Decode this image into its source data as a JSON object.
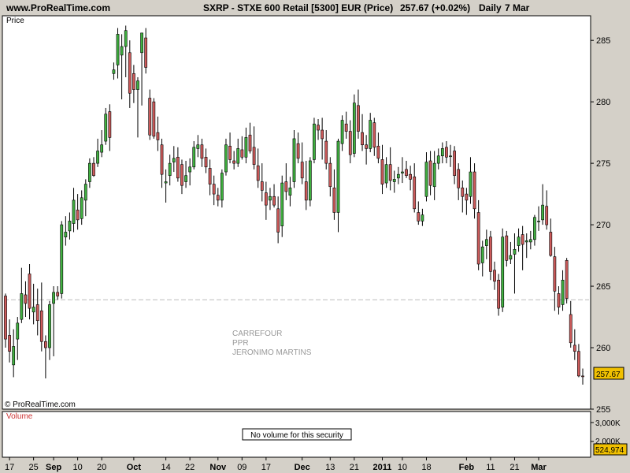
{
  "header": {
    "site": "www.ProRealTime.com",
    "title": "SXRP - STXE 600 Retail [5300] EUR (Price)",
    "price": "257.67 (+0.02%)",
    "period": "Daily",
    "date": "7 Mar"
  },
  "price_panel": {
    "label": "Price",
    "watermark": "© ProRealTime.com",
    "last_price_label": "257.67",
    "reference_level": 263.9,
    "annotations": [
      "CARREFOUR",
      "PPR",
      "JERONIMO MARTINS"
    ]
  },
  "volume_panel": {
    "label": "Volume",
    "message": "No volume for this security",
    "y_ticks": [
      "3,000K",
      "2,000K"
    ],
    "last_value_label": "524,974"
  },
  "colors": {
    "up": "#40b040",
    "down": "#cc5a5a",
    "wick": "#000000",
    "last_price_box": "#f0c000",
    "panel_bg": "#ffffff",
    "frame_bg": "#d4d0c8"
  },
  "chart_data": {
    "type": "candlestick",
    "ylim": [
      255,
      287
    ],
    "y_ticks": [
      255,
      260,
      265,
      270,
      275,
      280,
      285
    ],
    "x_ticks": [
      {
        "label": "17",
        "i": 1,
        "bold": false
      },
      {
        "label": "25",
        "i": 7,
        "bold": false
      },
      {
        "label": "Sep",
        "i": 12,
        "bold": true
      },
      {
        "label": "10",
        "i": 18,
        "bold": false
      },
      {
        "label": "20",
        "i": 24,
        "bold": false
      },
      {
        "label": "Oct",
        "i": 32,
        "bold": true
      },
      {
        "label": "14",
        "i": 40,
        "bold": false
      },
      {
        "label": "22",
        "i": 46,
        "bold": false
      },
      {
        "label": "Nov",
        "i": 53,
        "bold": true
      },
      {
        "label": "09",
        "i": 59,
        "bold": false
      },
      {
        "label": "17",
        "i": 65,
        "bold": false
      },
      {
        "label": "Dec",
        "i": 74,
        "bold": true
      },
      {
        "label": "13",
        "i": 81,
        "bold": false
      },
      {
        "label": "21",
        "i": 87,
        "bold": false
      },
      {
        "label": "2011",
        "i": 94,
        "bold": true
      },
      {
        "label": "10",
        "i": 99,
        "bold": false
      },
      {
        "label": "18",
        "i": 105,
        "bold": false
      },
      {
        "label": "Feb",
        "i": 115,
        "bold": true
      },
      {
        "label": "11",
        "i": 121,
        "bold": false
      },
      {
        "label": "21",
        "i": 127,
        "bold": false
      },
      {
        "label": "Mar",
        "i": 133,
        "bold": true
      }
    ],
    "candles": [
      {
        "o": 264.2,
        "h": 264.4,
        "l": 260.0,
        "c": 260.7
      },
      {
        "o": 261.0,
        "h": 262.3,
        "l": 258.8,
        "c": 259.7
      },
      {
        "o": 258.6,
        "h": 261.5,
        "l": 257.6,
        "c": 260.1
      },
      {
        "o": 260.7,
        "h": 262.5,
        "l": 259.0,
        "c": 262.0
      },
      {
        "o": 262.3,
        "h": 266.5,
        "l": 262.0,
        "c": 264.4
      },
      {
        "o": 264.3,
        "h": 265.4,
        "l": 262.5,
        "c": 263.6
      },
      {
        "o": 266.0,
        "h": 266.8,
        "l": 262.3,
        "c": 263.2
      },
      {
        "o": 262.9,
        "h": 265.2,
        "l": 261.9,
        "c": 263.3
      },
      {
        "o": 263.5,
        "h": 264.8,
        "l": 261.0,
        "c": 262.2
      },
      {
        "o": 263.0,
        "h": 265.3,
        "l": 259.7,
        "c": 260.5
      },
      {
        "o": 260.5,
        "h": 261.0,
        "l": 257.5,
        "c": 260.0
      },
      {
        "o": 260.0,
        "h": 263.8,
        "l": 259.0,
        "c": 263.5
      },
      {
        "o": 263.6,
        "h": 265.0,
        "l": 259.3,
        "c": 264.5
      },
      {
        "o": 264.5,
        "h": 265.0,
        "l": 263.9,
        "c": 264.2
      },
      {
        "o": 264.4,
        "h": 270.3,
        "l": 264.0,
        "c": 270.0
      },
      {
        "o": 269.0,
        "h": 270.7,
        "l": 268.3,
        "c": 269.4
      },
      {
        "o": 269.5,
        "h": 271.0,
        "l": 268.8,
        "c": 270.3
      },
      {
        "o": 270.1,
        "h": 273.0,
        "l": 269.4,
        "c": 272.0
      },
      {
        "o": 271.2,
        "h": 272.5,
        "l": 269.6,
        "c": 270.4
      },
      {
        "o": 270.5,
        "h": 272.8,
        "l": 270.0,
        "c": 272.2
      },
      {
        "o": 272.0,
        "h": 273.7,
        "l": 270.7,
        "c": 273.3
      },
      {
        "o": 273.5,
        "h": 275.4,
        "l": 273.0,
        "c": 275.0
      },
      {
        "o": 275.0,
        "h": 275.5,
        "l": 273.9,
        "c": 274.0
      },
      {
        "o": 275.0,
        "h": 277.0,
        "l": 274.7,
        "c": 276.0
      },
      {
        "o": 275.9,
        "h": 277.7,
        "l": 275.5,
        "c": 276.5
      },
      {
        "o": 276.8,
        "h": 279.5,
        "l": 276.5,
        "c": 279.0
      },
      {
        "o": 279.2,
        "h": 279.8,
        "l": 276.0,
        "c": 277.1
      },
      {
        "o": 282.3,
        "h": 283.2,
        "l": 281.8,
        "c": 282.6
      },
      {
        "o": 283.0,
        "h": 286.0,
        "l": 281.9,
        "c": 285.5
      },
      {
        "o": 283.8,
        "h": 285.5,
        "l": 280.2,
        "c": 284.5
      },
      {
        "o": 284.5,
        "h": 286.2,
        "l": 282.0,
        "c": 285.8
      },
      {
        "o": 284.0,
        "h": 285.0,
        "l": 279.5,
        "c": 280.7
      },
      {
        "o": 282.3,
        "h": 283.0,
        "l": 279.9,
        "c": 281.0
      },
      {
        "o": 281.0,
        "h": 282.0,
        "l": 277.1,
        "c": 281.7
      },
      {
        "o": 284.0,
        "h": 284.8,
        "l": 279.7,
        "c": 285.6
      },
      {
        "o": 285.2,
        "h": 286.0,
        "l": 282.3,
        "c": 282.8
      },
      {
        "o": 280.3,
        "h": 281.0,
        "l": 276.9,
        "c": 277.3
      },
      {
        "o": 280.0,
        "h": 280.3,
        "l": 277.0,
        "c": 277.2
      },
      {
        "o": 277.5,
        "h": 278.8,
        "l": 276.0,
        "c": 276.9
      },
      {
        "o": 276.5,
        "h": 277.0,
        "l": 273.0,
        "c": 274.1
      },
      {
        "o": 273.4,
        "h": 274.5,
        "l": 271.8,
        "c": 273.5
      },
      {
        "o": 274.0,
        "h": 275.7,
        "l": 273.2,
        "c": 275.0
      },
      {
        "o": 275.1,
        "h": 276.4,
        "l": 274.3,
        "c": 275.4
      },
      {
        "o": 275.5,
        "h": 276.3,
        "l": 273.5,
        "c": 273.8
      },
      {
        "o": 274.9,
        "h": 275.3,
        "l": 272.5,
        "c": 273.2
      },
      {
        "o": 273.5,
        "h": 275.2,
        "l": 273.0,
        "c": 274.0
      },
      {
        "o": 274.3,
        "h": 275.4,
        "l": 273.2,
        "c": 274.7
      },
      {
        "o": 274.7,
        "h": 276.8,
        "l": 274.5,
        "c": 276.3
      },
      {
        "o": 276.2,
        "h": 277.3,
        "l": 275.5,
        "c": 276.5
      },
      {
        "o": 276.5,
        "h": 277.0,
        "l": 274.7,
        "c": 275.4
      },
      {
        "o": 275.5,
        "h": 276.2,
        "l": 274.2,
        "c": 274.7
      },
      {
        "o": 274.6,
        "h": 275.3,
        "l": 272.4,
        "c": 273.3
      },
      {
        "o": 273.3,
        "h": 274.0,
        "l": 271.6,
        "c": 272.5
      },
      {
        "o": 272.4,
        "h": 273.0,
        "l": 271.5,
        "c": 272.0
      },
      {
        "o": 272.0,
        "h": 274.5,
        "l": 271.4,
        "c": 274.2
      },
      {
        "o": 274.3,
        "h": 277.0,
        "l": 274.0,
        "c": 276.5
      },
      {
        "o": 276.4,
        "h": 277.5,
        "l": 275.0,
        "c": 275.3
      },
      {
        "o": 275.2,
        "h": 276.0,
        "l": 274.5,
        "c": 275.0
      },
      {
        "o": 275.0,
        "h": 277.0,
        "l": 274.7,
        "c": 276.2
      },
      {
        "o": 276.1,
        "h": 277.2,
        "l": 275.3,
        "c": 275.5
      },
      {
        "o": 275.5,
        "h": 277.9,
        "l": 275.0,
        "c": 277.1
      },
      {
        "o": 277.3,
        "h": 278.3,
        "l": 275.8,
        "c": 276.0
      },
      {
        "o": 276.3,
        "h": 278.0,
        "l": 274.5,
        "c": 274.9
      },
      {
        "o": 274.8,
        "h": 276.2,
        "l": 273.0,
        "c": 273.6
      },
      {
        "o": 273.5,
        "h": 275.0,
        "l": 271.9,
        "c": 272.8
      },
      {
        "o": 272.6,
        "h": 273.5,
        "l": 270.4,
        "c": 271.6
      },
      {
        "o": 272.0,
        "h": 273.0,
        "l": 271.2,
        "c": 272.3
      },
      {
        "o": 272.3,
        "h": 273.3,
        "l": 271.4,
        "c": 271.6
      },
      {
        "o": 271.3,
        "h": 272.3,
        "l": 268.5,
        "c": 269.4
      },
      {
        "o": 269.9,
        "h": 274.0,
        "l": 269.0,
        "c": 273.4
      },
      {
        "o": 273.5,
        "h": 275.0,
        "l": 272.0,
        "c": 272.7
      },
      {
        "o": 272.4,
        "h": 273.9,
        "l": 271.5,
        "c": 273.0
      },
      {
        "o": 273.5,
        "h": 277.7,
        "l": 273.0,
        "c": 277.0
      },
      {
        "o": 276.6,
        "h": 277.5,
        "l": 275.0,
        "c": 275.4
      },
      {
        "o": 275.1,
        "h": 276.7,
        "l": 273.3,
        "c": 273.8
      },
      {
        "o": 273.5,
        "h": 275.2,
        "l": 271.2,
        "c": 272.0
      },
      {
        "o": 272.0,
        "h": 275.5,
        "l": 271.5,
        "c": 275.2
      },
      {
        "o": 275.3,
        "h": 278.7,
        "l": 275.0,
        "c": 278.2
      },
      {
        "o": 278.1,
        "h": 278.6,
        "l": 276.9,
        "c": 277.7
      },
      {
        "o": 277.7,
        "h": 278.7,
        "l": 275.3,
        "c": 277.0
      },
      {
        "o": 276.8,
        "h": 277.7,
        "l": 274.5,
        "c": 275.0
      },
      {
        "o": 275.0,
        "h": 275.5,
        "l": 272.3,
        "c": 273.1
      },
      {
        "o": 273.0,
        "h": 274.5,
        "l": 270.4,
        "c": 271.0
      },
      {
        "o": 271.0,
        "h": 277.0,
        "l": 269.4,
        "c": 276.8
      },
      {
        "o": 276.6,
        "h": 278.9,
        "l": 276.0,
        "c": 278.5
      },
      {
        "o": 278.2,
        "h": 279.2,
        "l": 277.0,
        "c": 277.6
      },
      {
        "o": 277.6,
        "h": 278.5,
        "l": 275.0,
        "c": 275.7
      },
      {
        "o": 275.8,
        "h": 280.6,
        "l": 275.5,
        "c": 279.9
      },
      {
        "o": 279.7,
        "h": 281.0,
        "l": 277.0,
        "c": 277.6
      },
      {
        "o": 277.5,
        "h": 279.0,
        "l": 276.0,
        "c": 276.5
      },
      {
        "o": 276.5,
        "h": 277.3,
        "l": 274.9,
        "c": 276.2
      },
      {
        "o": 276.2,
        "h": 279.1,
        "l": 275.9,
        "c": 278.5
      },
      {
        "o": 278.3,
        "h": 278.7,
        "l": 275.6,
        "c": 276.3
      },
      {
        "o": 276.4,
        "h": 277.5,
        "l": 275.0,
        "c": 275.4
      },
      {
        "o": 275.3,
        "h": 276.5,
        "l": 272.5,
        "c": 273.3
      },
      {
        "o": 273.4,
        "h": 275.5,
        "l": 273.0,
        "c": 274.9
      },
      {
        "o": 274.9,
        "h": 276.3,
        "l": 272.8,
        "c": 273.6
      },
      {
        "o": 273.5,
        "h": 274.4,
        "l": 272.6,
        "c": 273.7
      },
      {
        "o": 273.8,
        "h": 274.7,
        "l": 273.3,
        "c": 274.1
      },
      {
        "o": 274.2,
        "h": 275.5,
        "l": 273.4,
        "c": 274.3
      },
      {
        "o": 274.5,
        "h": 275.2,
        "l": 273.8,
        "c": 274.0
      },
      {
        "o": 274.1,
        "h": 274.8,
        "l": 272.8,
        "c": 273.7
      },
      {
        "o": 273.9,
        "h": 275.0,
        "l": 271.0,
        "c": 271.3
      },
      {
        "o": 271.0,
        "h": 271.9,
        "l": 270.0,
        "c": 270.3
      },
      {
        "o": 270.3,
        "h": 271.3,
        "l": 269.9,
        "c": 270.8
      },
      {
        "o": 272.3,
        "h": 275.9,
        "l": 271.9,
        "c": 275.1
      },
      {
        "o": 275.2,
        "h": 276.0,
        "l": 272.4,
        "c": 273.2
      },
      {
        "o": 273.1,
        "h": 276.0,
        "l": 272.0,
        "c": 275.0
      },
      {
        "o": 275.0,
        "h": 276.2,
        "l": 274.5,
        "c": 275.6
      },
      {
        "o": 275.6,
        "h": 276.7,
        "l": 275.0,
        "c": 276.2
      },
      {
        "o": 276.3,
        "h": 276.8,
        "l": 275.0,
        "c": 275.5
      },
      {
        "o": 275.6,
        "h": 276.5,
        "l": 274.7,
        "c": 275.6
      },
      {
        "o": 276.0,
        "h": 276.4,
        "l": 273.3,
        "c": 274.0
      },
      {
        "o": 274.5,
        "h": 275.0,
        "l": 272.0,
        "c": 273.0
      },
      {
        "o": 273.0,
        "h": 273.6,
        "l": 271.0,
        "c": 272.3
      },
      {
        "o": 272.5,
        "h": 273.0,
        "l": 270.8,
        "c": 272.0
      },
      {
        "o": 272.3,
        "h": 275.5,
        "l": 271.7,
        "c": 274.3
      },
      {
        "o": 274.3,
        "h": 275.0,
        "l": 270.5,
        "c": 271.3
      },
      {
        "o": 271.0,
        "h": 272.0,
        "l": 266.3,
        "c": 266.8
      },
      {
        "o": 266.9,
        "h": 268.7,
        "l": 265.8,
        "c": 268.2
      },
      {
        "o": 268.3,
        "h": 269.6,
        "l": 267.2,
        "c": 268.8
      },
      {
        "o": 269.0,
        "h": 269.5,
        "l": 265.5,
        "c": 266.2
      },
      {
        "o": 266.3,
        "h": 267.0,
        "l": 264.7,
        "c": 265.4
      },
      {
        "o": 265.5,
        "h": 266.0,
        "l": 262.6,
        "c": 263.2
      },
      {
        "o": 263.3,
        "h": 269.7,
        "l": 262.9,
        "c": 269.0
      },
      {
        "o": 269.1,
        "h": 269.5,
        "l": 266.6,
        "c": 267.1
      },
      {
        "o": 267.2,
        "h": 268.6,
        "l": 266.8,
        "c": 267.5
      },
      {
        "o": 267.6,
        "h": 269.3,
        "l": 264.4,
        "c": 268.0
      },
      {
        "o": 268.3,
        "h": 269.7,
        "l": 267.8,
        "c": 269.0
      },
      {
        "o": 269.2,
        "h": 269.9,
        "l": 266.3,
        "c": 268.4
      },
      {
        "o": 268.6,
        "h": 269.3,
        "l": 267.3,
        "c": 268.7
      },
      {
        "o": 268.6,
        "h": 269.5,
        "l": 268.0,
        "c": 268.8
      },
      {
        "o": 268.8,
        "h": 270.8,
        "l": 268.3,
        "c": 270.6
      },
      {
        "o": 270.3,
        "h": 271.5,
        "l": 269.5,
        "c": 270.3
      },
      {
        "o": 270.4,
        "h": 273.3,
        "l": 270.0,
        "c": 271.6
      },
      {
        "o": 271.5,
        "h": 272.8,
        "l": 269.6,
        "c": 270.0
      },
      {
        "o": 269.4,
        "h": 270.5,
        "l": 267.4,
        "c": 267.5
      },
      {
        "o": 267.4,
        "h": 268.2,
        "l": 263.0,
        "c": 264.6
      },
      {
        "o": 264.4,
        "h": 265.0,
        "l": 262.7,
        "c": 263.3
      },
      {
        "o": 263.5,
        "h": 266.3,
        "l": 263.0,
        "c": 265.5
      },
      {
        "o": 267.1,
        "h": 267.3,
        "l": 263.6,
        "c": 264.0
      },
      {
        "o": 262.7,
        "h": 263.8,
        "l": 260.0,
        "c": 260.4
      },
      {
        "o": 260.2,
        "h": 261.5,
        "l": 259.0,
        "c": 259.7
      },
      {
        "o": 259.7,
        "h": 260.3,
        "l": 257.6,
        "c": 257.7
      },
      {
        "o": 257.7,
        "h": 258.3,
        "l": 257.0,
        "c": 257.67
      }
    ]
  }
}
